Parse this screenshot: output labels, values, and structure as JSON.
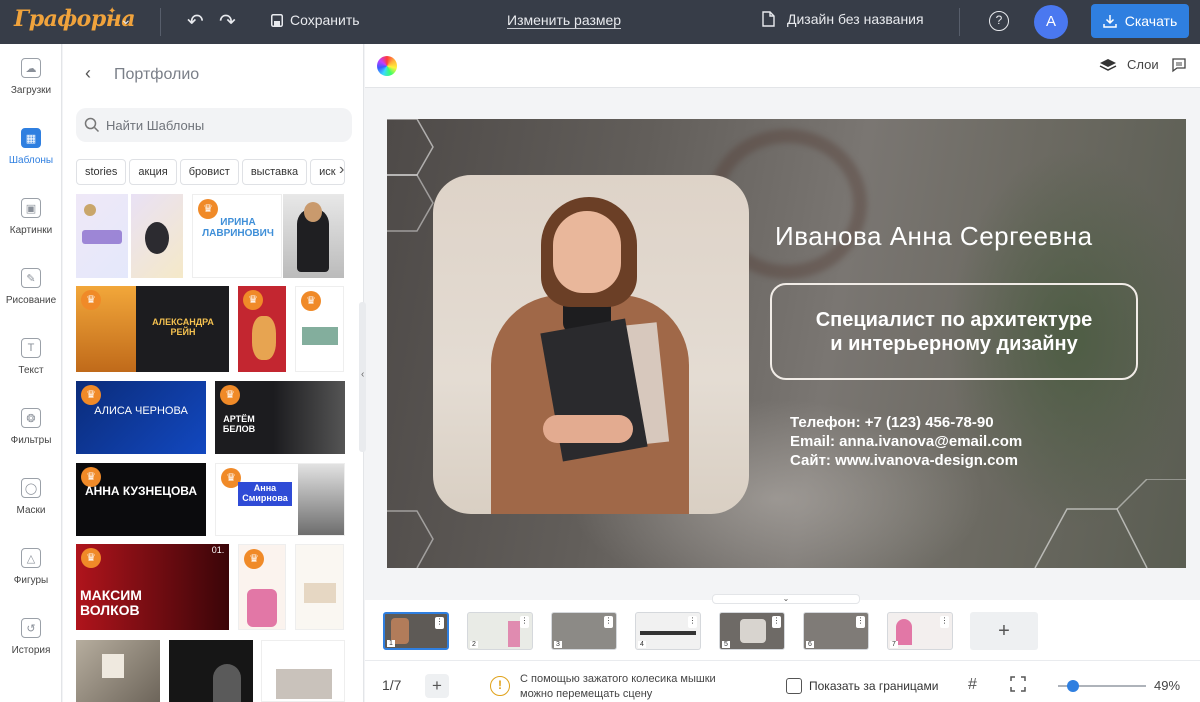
{
  "header": {
    "logo": "Графорна",
    "save_label": "Сохранить",
    "resize_label": "Изменить размер",
    "doc_title": "Дизайн без названия",
    "help_label": "?",
    "avatar_initial": "А",
    "download_label": "Скачать"
  },
  "left_tools": [
    {
      "label": "Загрузки",
      "icon": "cloud-icon"
    },
    {
      "label": "Шаблоны",
      "icon": "templates-icon"
    },
    {
      "label": "Картинки",
      "icon": "image-icon"
    },
    {
      "label": "Рисование",
      "icon": "pencil-icon"
    },
    {
      "label": "Текст",
      "icon": "text-icon"
    },
    {
      "label": "Фильтры",
      "icon": "filter-icon"
    },
    {
      "label": "Маски",
      "icon": "mask-icon"
    },
    {
      "label": "Фигуры",
      "icon": "shapes-icon"
    },
    {
      "label": "История",
      "icon": "history-icon"
    }
  ],
  "panel": {
    "title": "Портфолио",
    "search_placeholder": "Найти Шаблоны",
    "tags": [
      "stories",
      "акция",
      "бровист",
      "выставка",
      "иск"
    ]
  },
  "templates": {
    "t1": "ИРИНА ЛАВРИНОВИЧ",
    "t2": "АЛЕКСАНДРА РЕЙН",
    "t3": "АЛИСА ЧЕРНОВА",
    "t4": "АРТЁМ БЕЛОВ",
    "t5": "АННА КУЗНЕЦОВА",
    "t6": "Анна Смирнова",
    "t7": "МАКСИМ ВОЛКОВ",
    "t7_num": "01."
  },
  "toolbar_right": {
    "layers_label": "Слои"
  },
  "design": {
    "name": "Иванова Анна Сергеевна",
    "title_line1": "Специалист по архитектуре",
    "title_line2": "и интерьерному дизайну",
    "phone": "Телефон: +7 (123) 456-78-90",
    "email": "Email: anna.ivanova@email.com",
    "site": "Сайт: www.ivanova-design.com"
  },
  "pages": {
    "numbers": [
      "1",
      "2",
      "3",
      "4",
      "5",
      "6",
      "7"
    ],
    "add_label": "+"
  },
  "status": {
    "page_count": "1/7",
    "hint": "С помощью зажатого колесика мышки можно перемещать сцену",
    "show_outside": "Показать за границами",
    "zoom": "49%",
    "zoom_fraction": 0.1
  },
  "colors": {
    "accent": "#2f7fe0",
    "topbar": "#373d48",
    "logo": "#f0a33c",
    "crown": "#f08a28"
  }
}
